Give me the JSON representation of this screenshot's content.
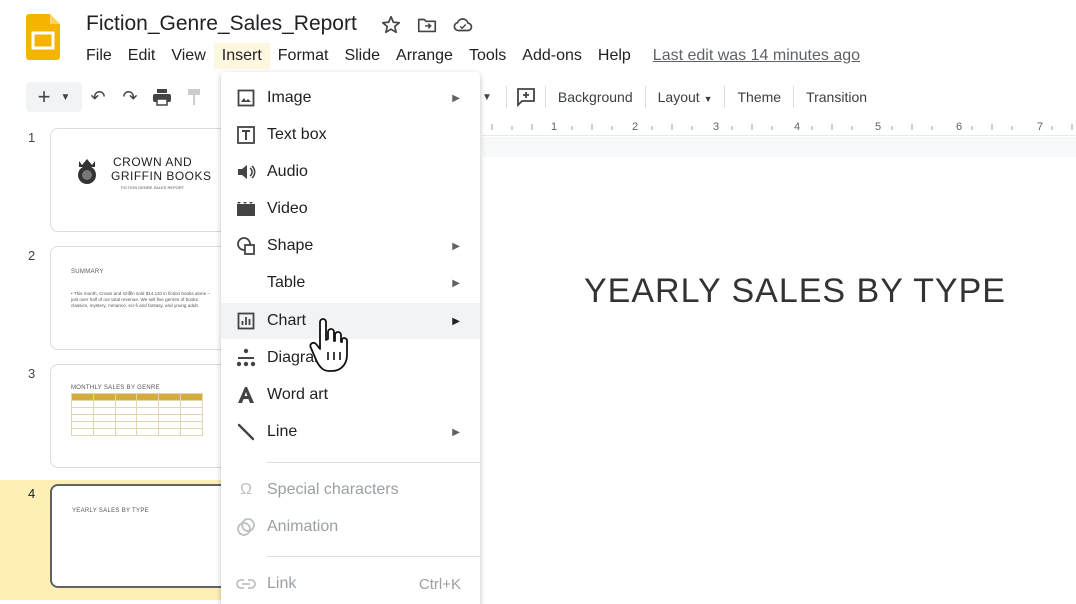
{
  "app": {
    "title": "Fiction_Genre_Sales_Report",
    "last_edit": "Last edit was 14 minutes ago",
    "menu": [
      "File",
      "Edit",
      "View",
      "Insert",
      "Format",
      "Slide",
      "Arrange",
      "Tools",
      "Add-ons",
      "Help"
    ],
    "active_menu": "Insert"
  },
  "toolbar": {
    "background": "Background",
    "layout": "Layout",
    "theme": "Theme",
    "transition": "Transition"
  },
  "ruler": [
    "1",
    "2",
    "3",
    "4",
    "5",
    "6",
    "7"
  ],
  "slides": [
    {
      "num": "1",
      "title_line1": "CROWN AND",
      "title_line2": "GRIFFIN BOOKS",
      "subtitle": "FICTION GENRE SALES REPORT"
    },
    {
      "num": "2",
      "heading": "SUMMARY",
      "body": "• This month, Crown and Griffin sold $14,110 in fiction books alone – just over half of our total revenue. We sell five genres of books: classics, mystery, romance, sci-fi and fantasy, and young adult."
    },
    {
      "num": "3",
      "heading": "MONTHLY SALES BY GENRE"
    },
    {
      "num": "4",
      "heading": "YEARLY SALES BY TYPE"
    }
  ],
  "canvas": {
    "heading": "YEARLY SALES BY TYPE"
  },
  "insert_menu": {
    "items": [
      {
        "label": "Image",
        "icon": "image-icon",
        "submenu": true
      },
      {
        "label": "Text box",
        "icon": "text-box-icon",
        "submenu": false
      },
      {
        "label": "Audio",
        "icon": "audio-icon",
        "submenu": false
      },
      {
        "label": "Video",
        "icon": "video-icon",
        "submenu": false
      },
      {
        "label": "Shape",
        "icon": "shape-icon",
        "submenu": true
      },
      {
        "label": "Table",
        "icon": "",
        "submenu": true
      },
      {
        "label": "Chart",
        "icon": "chart-icon",
        "submenu": true,
        "hover": true
      },
      {
        "label": "Diagram",
        "icon": "diagram-icon",
        "submenu": false
      },
      {
        "label": "Word art",
        "icon": "word-art-icon",
        "submenu": false
      },
      {
        "label": "Line",
        "icon": "line-icon",
        "submenu": true
      },
      {
        "label": "Special characters",
        "icon": "omega-icon",
        "disabled": true
      },
      {
        "label": "Animation",
        "icon": "animation-icon",
        "disabled": true
      },
      {
        "label": "Link",
        "icon": "link-icon",
        "disabled": true,
        "shortcut": "Ctrl+K"
      }
    ]
  },
  "colors": {
    "slides_yellow": "#f4b400",
    "active_menu_bg": "#fef7e0",
    "selected_slide_bg": "#fdefb6",
    "hover_bg": "#f1f3f4"
  }
}
